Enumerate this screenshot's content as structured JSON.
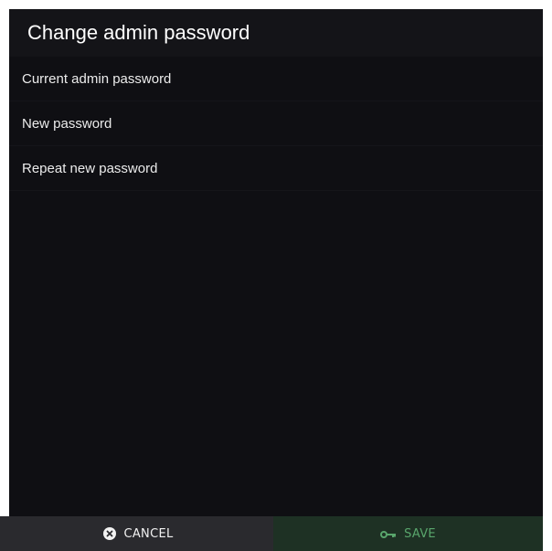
{
  "dialog": {
    "title": "Change admin password"
  },
  "fields": [
    {
      "label": "Current admin password"
    },
    {
      "label": "New password"
    },
    {
      "label": "Repeat new password"
    }
  ],
  "footer": {
    "cancel_label": "CANCEL",
    "cancel_icon": "circle-x-icon",
    "save_label": "SAVE",
    "save_icon": "key-icon"
  },
  "colors": {
    "background": "#0f0f13",
    "header": "#141418",
    "cancel_bg": "#2a2a2e",
    "save_bg": "#1e3124",
    "save_text": "#59a66c"
  }
}
